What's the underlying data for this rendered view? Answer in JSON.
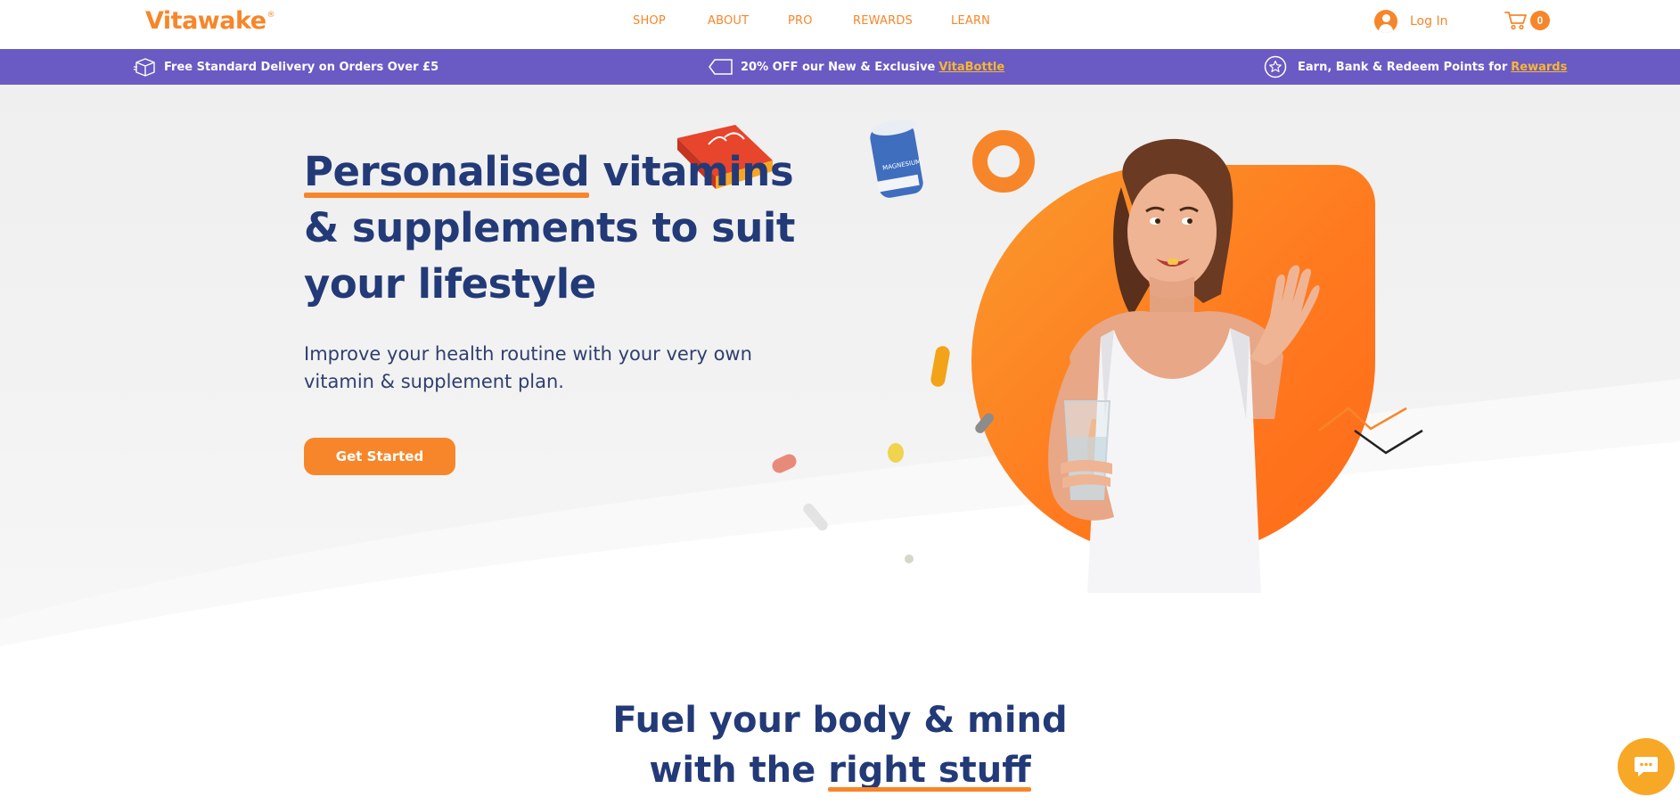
{
  "brand": {
    "name": "Vitawake",
    "mark": "®"
  },
  "nav": {
    "items": [
      "SHOP",
      "ABOUT",
      "PRO",
      "REWARDS",
      "LEARN"
    ]
  },
  "account": {
    "login_label": "Log In",
    "cart_count": "0"
  },
  "promo": {
    "delivery": "Free Standard Delivery on Orders Over £5",
    "discount_prefix": "20% OFF our New & Exclusive",
    "discount_link": "VitaBottle",
    "rewards_prefix": "Earn, Bank & Redeem Points for",
    "rewards_link": "Rewards"
  },
  "hero": {
    "headline_highlight": "Personalised",
    "headline_rest_1": " vitamins",
    "headline_line2": "& supplements to suit",
    "headline_line3": "your lifestyle",
    "subtext": "Improve your health routine with your very own vitamin & supplement plan.",
    "cta_label": "Get Started",
    "product_tin_label": "MAGNESIUM"
  },
  "section_fuel": {
    "line1": "Fuel your body & mind",
    "line2_prefix": "with the ",
    "line2_highlight": "right stuff"
  },
  "colors": {
    "brand_orange": "#f7862a",
    "navy": "#233a78",
    "promo_purple": "#6a5ac3",
    "link_yellow": "#f7b733"
  },
  "icons": [
    "box-icon",
    "tag-icon",
    "star-icon",
    "user-icon",
    "cart-icon",
    "chat-icon"
  ]
}
